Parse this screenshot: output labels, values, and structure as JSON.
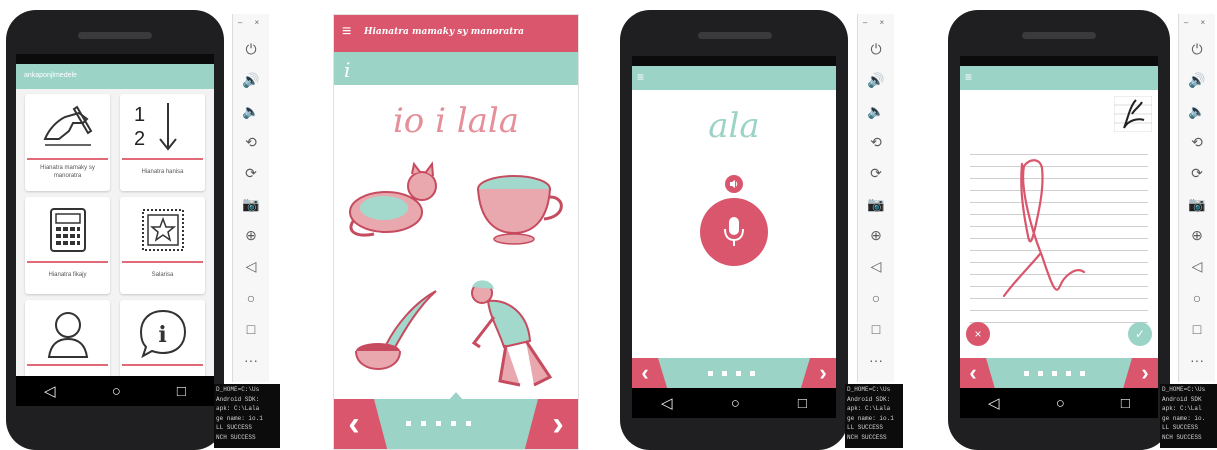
{
  "colors": {
    "teal": "#9bd3c7",
    "pink": "#d9566d",
    "frame": "#1f1f21"
  },
  "toolbar": {
    "window_controls": "– ×",
    "icons": [
      "power-icon",
      "volume-up-icon",
      "volume-down-icon",
      "rotate-left-icon",
      "rotate-right-icon",
      "camera-icon",
      "zoom-icon",
      "back-icon",
      "home-icon",
      "overview-icon",
      "more-icon"
    ],
    "glyphs": [
      "⏻",
      "🔊",
      "🔈",
      "⟲",
      "⟳",
      "📷",
      "⊕",
      "◁",
      "○",
      "□",
      "···"
    ]
  },
  "navbar": {
    "back": "◁",
    "home": "○",
    "recents": "□"
  },
  "phone1": {
    "app_title": "ankaponjlmedele",
    "tiles": [
      {
        "label": "Hianatra mamaky sy manoratra",
        "icon": "write-hand-icon"
      },
      {
        "label": "Hianatra hanisa",
        "icon": "numbers-icon",
        "numbers": [
          "1",
          "2"
        ]
      },
      {
        "label": "Hianatra fikajy",
        "icon": "calculator-icon"
      },
      {
        "label": "Salarisa",
        "icon": "star-icon"
      },
      {
        "label": "",
        "icon": "user-icon"
      },
      {
        "label": "",
        "icon": "info-icon",
        "glyph": "i"
      }
    ]
  },
  "phone2": {
    "header_title": "Hianatra mamaky sy manoratra",
    "menu": "≡",
    "letter": "i",
    "phrase": "io i lala",
    "pictures": [
      "cat-picture",
      "cup-picture",
      "pipe-picture",
      "kneeling-person-picture"
    ],
    "prev": "‹",
    "next": "›",
    "pages": 5
  },
  "phone3": {
    "menu": "≡",
    "word": "ala",
    "prev": "‹",
    "next": "›",
    "pages": 4
  },
  "phone4": {
    "menu": "≡",
    "prev": "‹",
    "next": "›",
    "pages": 5,
    "clear": "×",
    "confirm": "✓"
  },
  "console_a": [
    "D_HOME=C:\\Us",
    "Android SDK:",
    "apk: C:\\Lala",
    "ge name: io.1",
    "LL SUCCESS",
    "NCH SUCCESS"
  ],
  "console_b": [
    "D_HOME=C:\\Us",
    "Android SDK:",
    "apk: C:\\Lala",
    "ge name: io.1",
    "LL SUCCESS",
    "NCH SUCCESS"
  ],
  "console_c": [
    "D_HOME=C:\\Us",
    "Android SDK",
    "apk: C:\\Lal",
    "ge name: io.",
    "LL SUCCESS",
    "NCH SUCCESS"
  ]
}
